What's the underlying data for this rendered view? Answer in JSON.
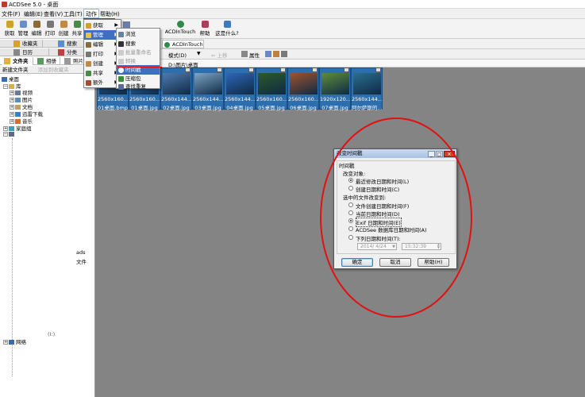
{
  "window": {
    "title": "ACDSee 5.0 - 桌面"
  },
  "menubar": {
    "items": [
      {
        "label": "文件(F)"
      },
      {
        "label": "编辑(E)"
      },
      {
        "label": "查看(V)"
      },
      {
        "label": "工具(T)"
      },
      {
        "label": "动作"
      },
      {
        "label": "帮助(H)"
      }
    ]
  },
  "toolbar": {
    "buttons": [
      {
        "label": "获取"
      },
      {
        "label": "管理"
      },
      {
        "label": "编辑"
      },
      {
        "label": "打印"
      },
      {
        "label": "创建"
      },
      {
        "label": "共享"
      },
      {
        "label": "ACDInTouch"
      },
      {
        "label": "帮助"
      },
      {
        "label": "这是什么?"
      }
    ]
  },
  "left_panel": {
    "tabs_row1": [
      {
        "label": "收藏夹"
      },
      {
        "label": "搜索"
      }
    ],
    "tabs_row2": [
      {
        "label": "日历"
      },
      {
        "label": "分类"
      }
    ],
    "tabs_row3": [
      {
        "label": "文件夹"
      },
      {
        "label": "相册"
      },
      {
        "label": "照片"
      }
    ],
    "folder_toolbar": {
      "new_folder": "新建文件夹",
      "add_favorite": "添加到收藏夹"
    },
    "tree": {
      "desktop": "桌面",
      "library": "库",
      "video": "视频",
      "pictures": "图片",
      "documents": "文档",
      "thunder": "迅雷下载",
      "music": "音乐",
      "homegroup": "家庭组",
      "fragment_1": "ads",
      "fragment_2": "文件",
      "fragment_3": "(I:)",
      "network": "网络"
    }
  },
  "action_menu": {
    "items": [
      {
        "label": "获取"
      },
      {
        "label": "管理"
      },
      {
        "label": "编辑"
      },
      {
        "label": "打印"
      },
      {
        "label": "创建"
      },
      {
        "label": "共享"
      },
      {
        "label": "额外"
      }
    ]
  },
  "manage_submenu": {
    "items": [
      {
        "label": "浏览"
      },
      {
        "label": "搜索"
      },
      {
        "label": "批量重命名"
      },
      {
        "label": "转换"
      },
      {
        "label": "时间戳"
      },
      {
        "label": "压缩包"
      },
      {
        "label": "查找重复"
      }
    ]
  },
  "path_bar": {
    "mode_label": "模式(D)",
    "back_label": "⇐ 上移",
    "properties": "属性",
    "path_label": "D:\\图片\\桌面",
    "acdintouch": "ACDInTouch"
  },
  "thumbnails": [
    {
      "size": "2560x160...",
      "name": "01桌面.bmp",
      "color": "#2a5d96"
    },
    {
      "size": "2560x160...",
      "name": "01桌面.jpg",
      "color": "#3c7cc4"
    },
    {
      "size": "2560x144...",
      "name": "02桌面.jpg",
      "color": "#4f7ab0"
    },
    {
      "size": "2560x144...",
      "name": "03桌面.jpg",
      "color": "#7fa5c7"
    },
    {
      "size": "2560x144...",
      "name": "04桌面.jpg",
      "color": "#2f65b8"
    },
    {
      "size": "2560x160...",
      "name": "05桌面.jpg",
      "color": "#2d5a2b"
    },
    {
      "size": "2560x160...",
      "name": "06桌面.jpg",
      "color": "#a0522d"
    },
    {
      "size": "1920x120...",
      "name": "07桌面.jpg",
      "color": "#5e8c3a"
    },
    {
      "size": "2560x144...",
      "name": "阿尔萨斯的...",
      "color": "#2b6e8f"
    }
  ],
  "dialog": {
    "title": "改变时间戳",
    "group_label": "时间戳",
    "change_target": "改变对象:",
    "opt_last_modified": "最近修改日期和时间(L)",
    "opt_created": "创建日期和时间(C)",
    "change_to": "选中的文件改变到:",
    "opt_file_created": "文件创建日期和时间(F)",
    "opt_current": "当前日期和时间(D)",
    "opt_exif": "Exif 日期和时间(E)",
    "opt_acdsee_db": "ACDSee 数据库日期和时间(A)",
    "opt_following": "下列日期和时间(T):",
    "date_value": "2014/ 4/24",
    "time_value": "15:32:39",
    "ok": "确定",
    "cancel": "取消",
    "help": "帮助(H)"
  }
}
